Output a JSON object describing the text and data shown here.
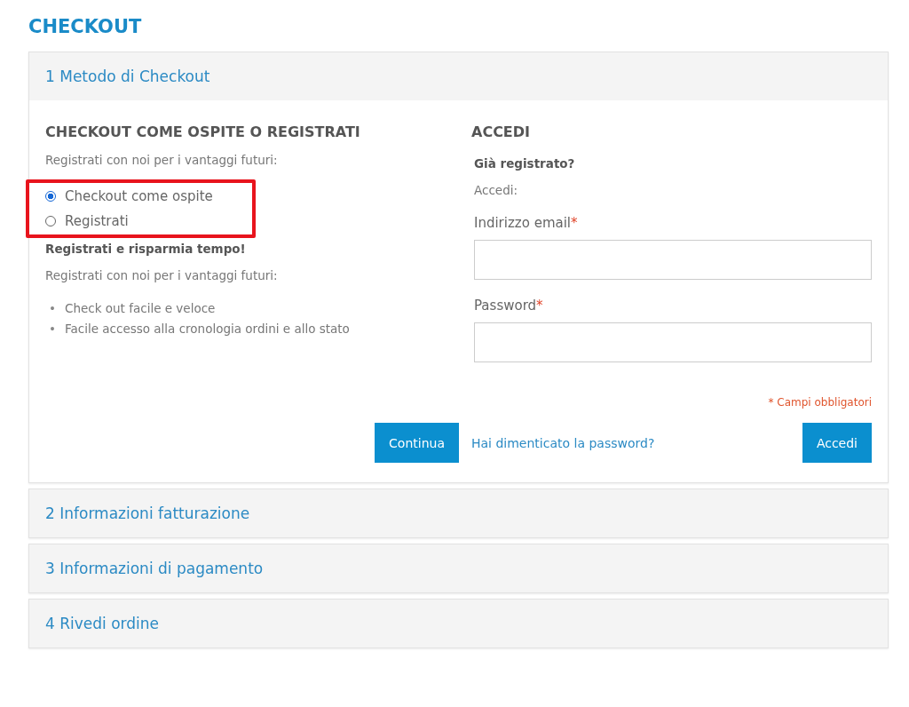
{
  "page_title": "CHECKOUT",
  "sections": [
    {
      "label": "1 Metodo di Checkout",
      "expanded": true
    },
    {
      "label": "2 Informazioni fatturazione",
      "expanded": false
    },
    {
      "label": "3 Informazioni di pagamento",
      "expanded": false
    },
    {
      "label": "4 Rivedi ordine",
      "expanded": false
    }
  ],
  "guest": {
    "heading": "CHECKOUT COME OSPITE O REGISTRATI",
    "intro": "Registrati con noi per i vantaggi futuri:",
    "highlighted": true,
    "options": [
      {
        "label": "Checkout come ospite",
        "selected": true
      },
      {
        "label": "Registrati",
        "selected": false
      }
    ],
    "subheading": "Registrati e risparmia tempo!",
    "text": "Registrati con noi per i vantaggi futuri:",
    "benefits": [
      {
        "marker": "•",
        "text": "Check out facile e veloce"
      },
      {
        "marker": "•",
        "text": "Facile accesso alla cronologia ordini e allo stato"
      }
    ],
    "button": "Continua"
  },
  "login": {
    "heading": "ACCEDI",
    "subheading": "Già registrato?",
    "text": "Accedi:",
    "fields": [
      {
        "label": "Indirizzo email",
        "required_mark": "*"
      },
      {
        "label": "Password",
        "required_mark": "*"
      }
    ],
    "required_note": "* Campi obbligatori",
    "forgot_link": "Hai dimenticato la password?",
    "button": "Accedi"
  }
}
